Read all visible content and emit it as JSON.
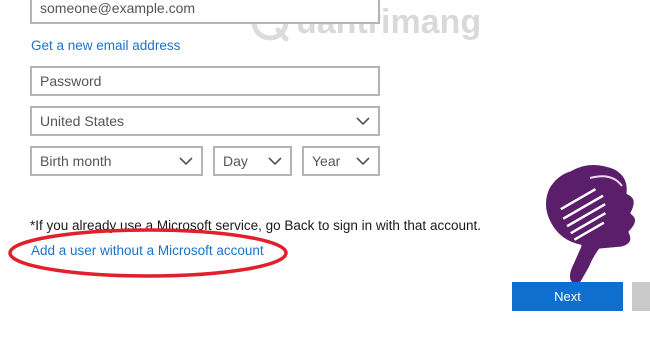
{
  "form": {
    "email_value": "someone@example.com",
    "new_email_link": "Get a new email address",
    "password_placeholder": "Password",
    "country_value": "United States",
    "birth_month_value": "Birth month",
    "day_value": "Day",
    "year_value": "Year"
  },
  "notice": {
    "text": "*If you already use a Microsoft service, go Back to sign in with that account.",
    "no_account_link": "Add a user without a Microsoft account"
  },
  "buttons": {
    "next_label": "Next"
  },
  "watermark": {
    "text": "uantrimang"
  },
  "colors": {
    "link": "#1a73c8",
    "button": "#0f6fce",
    "annotation_circle": "#e0202c",
    "hand_fill": "#5b1e6a"
  },
  "icons": {
    "select_arrow": "chevron-down-icon",
    "pointer": "pointing-hand-icon"
  }
}
